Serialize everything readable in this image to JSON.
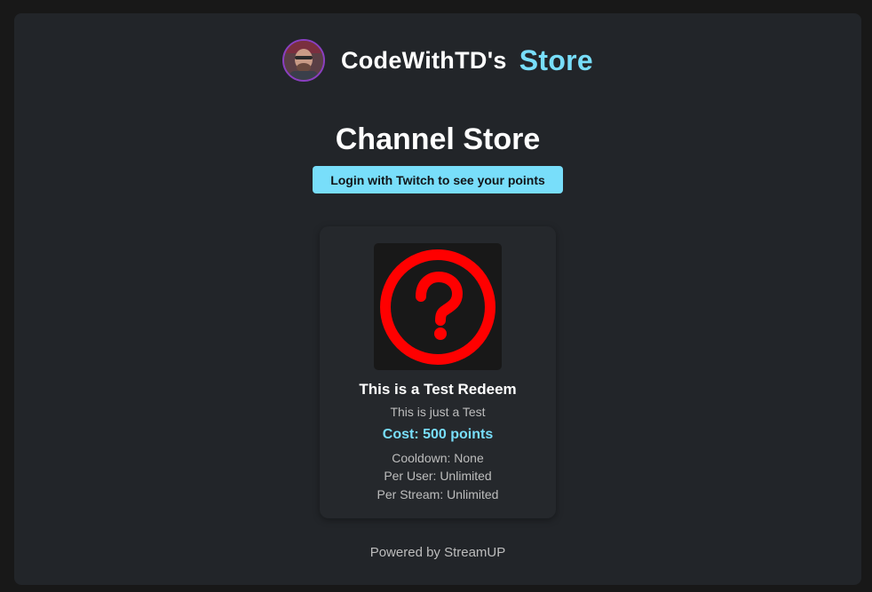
{
  "header": {
    "owner": "CodeWithTD's",
    "store_word": "Store"
  },
  "page_title": "Channel Store",
  "login_button": "Login with Twitch to see your points",
  "items": [
    {
      "icon": "question-circle-icon",
      "icon_color": "#ff0000",
      "name": "This is a Test Redeem",
      "description": "This is just a Test",
      "cost": "Cost: 500 points",
      "cooldown": "Cooldown: None",
      "per_user": "Per User: Unlimited",
      "per_stream": "Per Stream: Unlimited"
    }
  ],
  "footer": "Powered by StreamUP",
  "colors": {
    "accent": "#78defa",
    "background": "#181818",
    "panel": "#222529",
    "avatar_ring": "#8a3fc0"
  }
}
